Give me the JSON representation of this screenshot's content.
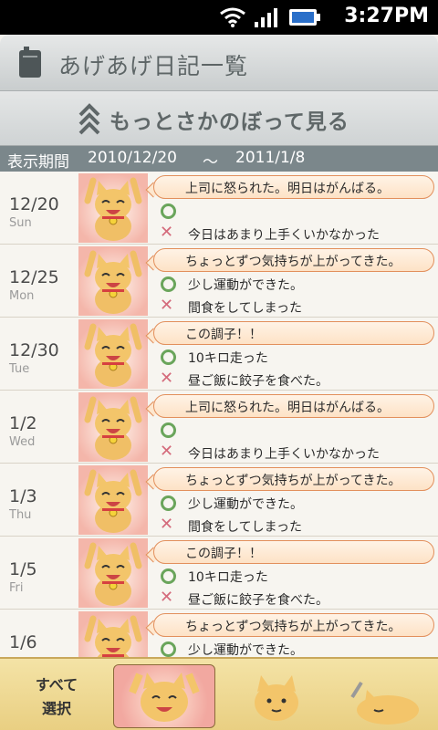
{
  "status": {
    "time": "3:27PM"
  },
  "header": {
    "title": "あげあげ日記一覧"
  },
  "more": {
    "label": "もっとさかのぼって見る"
  },
  "period": {
    "label": "表示期間",
    "start": "2010/12/20",
    "sep": "〜",
    "end": "2011/1/8"
  },
  "entries": [
    {
      "date": "12/20",
      "dow": "Sun",
      "bubble": "上司に怒られた。明日はがんばる。",
      "good": "",
      "bad": "今日はあまり上手くいかなかった"
    },
    {
      "date": "12/25",
      "dow": "Mon",
      "bubble": "ちょっとずつ気持ちが上がってきた。",
      "good": "少し運動ができた。",
      "bad": "間食をしてしまった"
    },
    {
      "date": "12/30",
      "dow": "Tue",
      "bubble": "この調子！！",
      "good": "10キロ走った",
      "bad": "昼ご飯に餃子を食べた。"
    },
    {
      "date": "1/2",
      "dow": "Wed",
      "bubble": "上司に怒られた。明日はがんばる。",
      "good": "",
      "bad": "今日はあまり上手くいかなかった"
    },
    {
      "date": "1/3",
      "dow": "Thu",
      "bubble": "ちょっとずつ気持ちが上がってきた。",
      "good": "少し運動ができた。",
      "bad": "間食をしてしまった"
    },
    {
      "date": "1/5",
      "dow": "Fri",
      "bubble": "この調子！！",
      "good": "10キロ走った",
      "bad": "昼ご飯に餃子を食べた。"
    },
    {
      "date": "1/6",
      "dow": "",
      "bubble": "ちょっとずつ気持ちが上がってきた。",
      "good": "少し運動ができた。",
      "bad": ""
    }
  ],
  "bottom": {
    "select_all": "すべて\n選択"
  },
  "colors": {
    "accent": "#e28f5c",
    "good": "#6aa55b",
    "bad": "#d46a7b"
  }
}
